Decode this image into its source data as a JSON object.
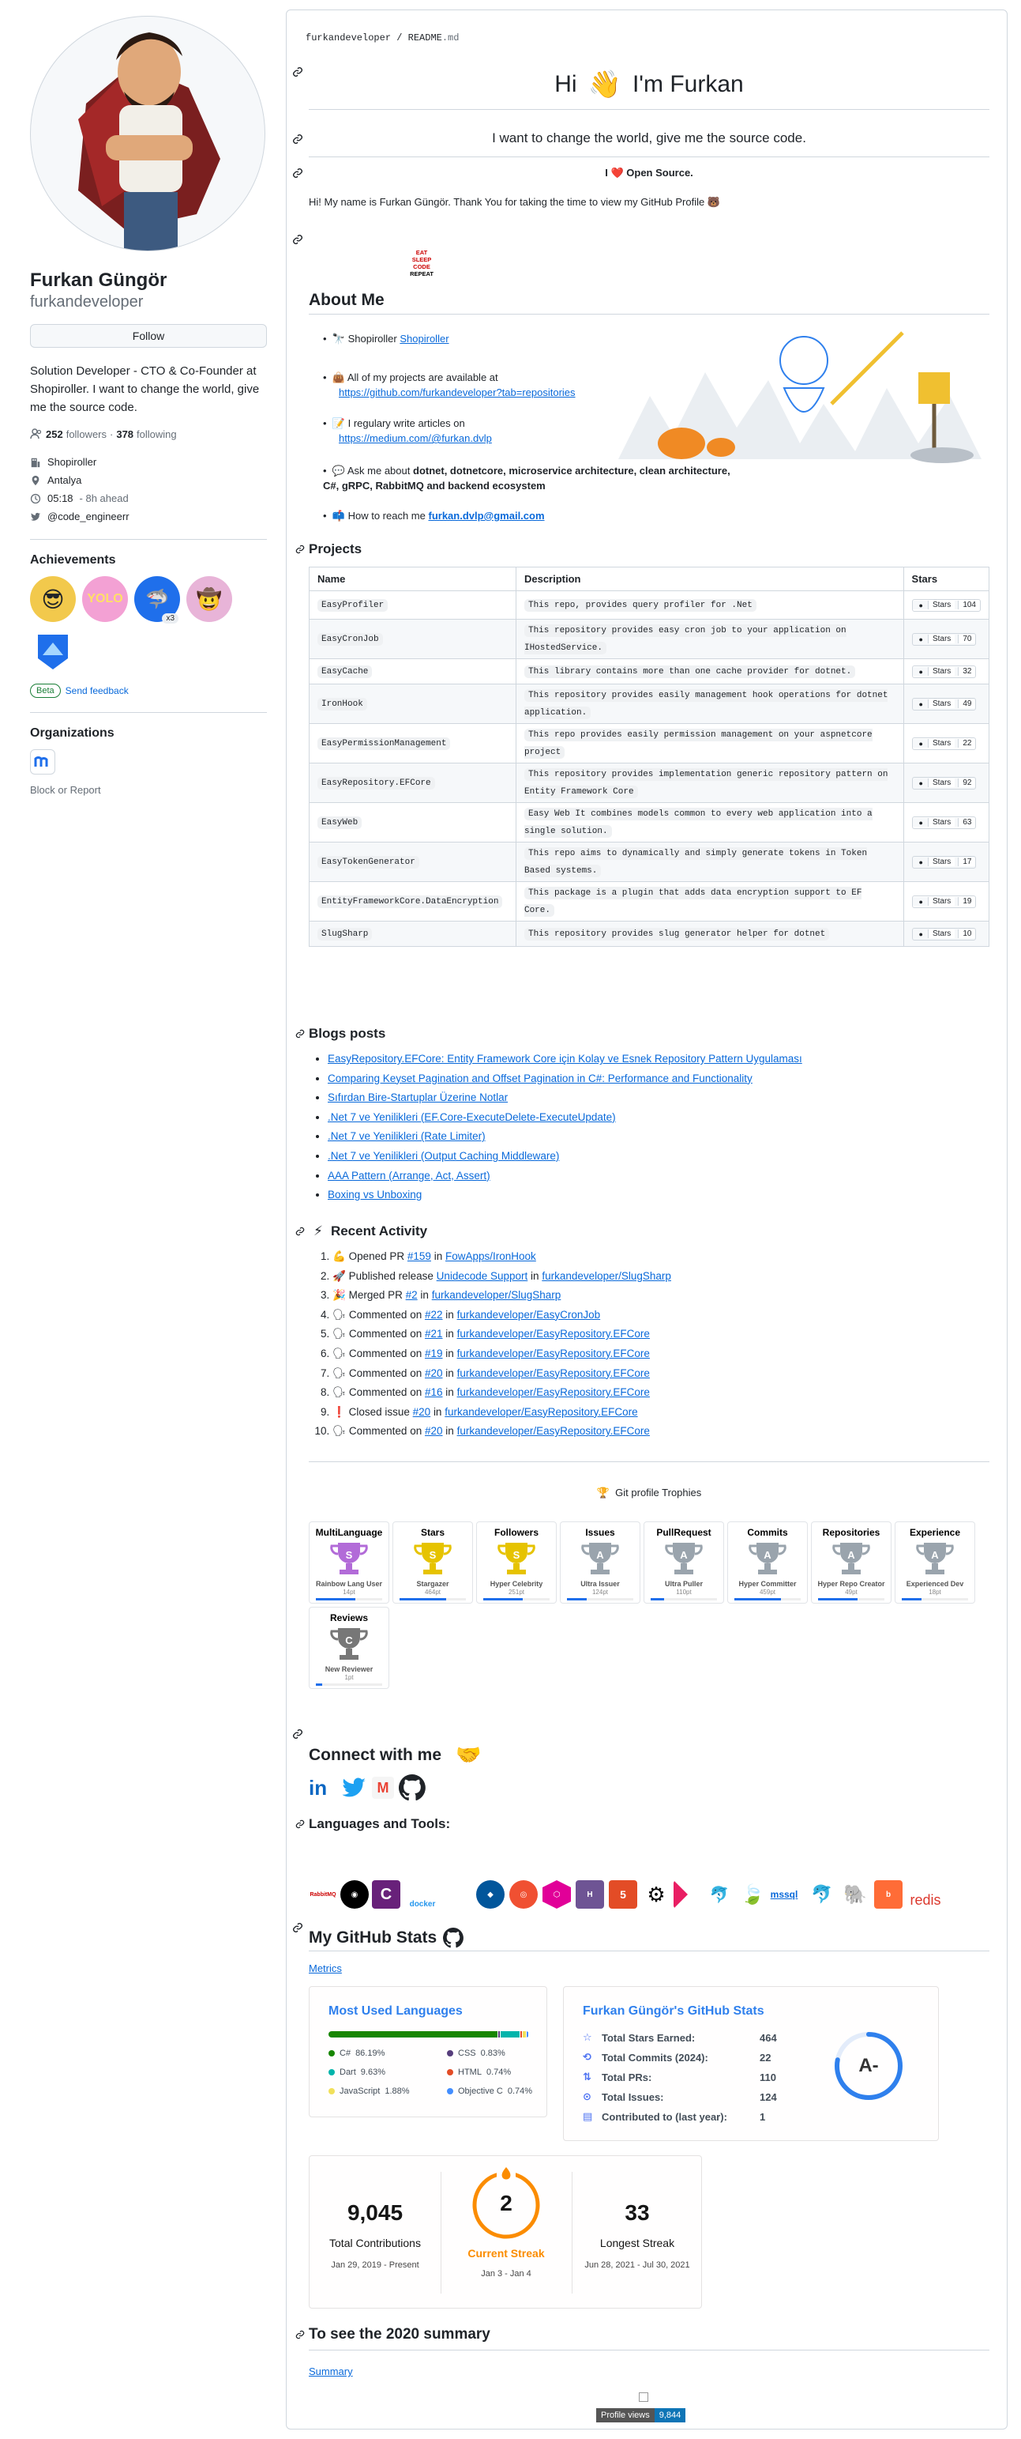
{
  "profile": {
    "name": "Furkan Güngör",
    "login": "furkandeveloper",
    "follow_label": "Follow",
    "bio": "Solution Developer - CTO & Co-Founder at Shopiroller. I want to change the world, give me the source code.",
    "followers": "252",
    "followers_label": "followers",
    "following": "378",
    "following_label": "following",
    "company": "Shopiroller",
    "location": "Antalya",
    "time": "05:18",
    "time_ahead": "- 8h ahead",
    "twitter": "@code_engineerr",
    "achievements_title": "Achievements",
    "achievement_count": "x3",
    "beta": "Beta",
    "send_feedback": "Send feedback",
    "orgs_title": "Organizations",
    "block": "Block or Report"
  },
  "readme": {
    "path_user": "furkandeveloper",
    "path_file": "README",
    "path_ext": ".md",
    "hi": "Hi",
    "hi_name": "I'm Furkan",
    "tagline": "I want to change the world, give me the source code.",
    "love_pre": "I",
    "love_post": "Open Source.",
    "intro": "Hi! My name is Furkan Güngör. Thank You for taking the time to view my GitHub Profile",
    "eat_lines": [
      "EAT",
      "SLEEP",
      "CODE",
      "REPEAT"
    ],
    "about_title": "About Me",
    "about": {
      "item1_text": "Shopiroller",
      "item1_link": "Shopiroller",
      "item2_text": "All of my projects are available at",
      "item2_link": "https://github.com/furkandeveloper?tab=repositories",
      "item3_text": "I regulary write articles on",
      "item3_link": "https://medium.com/@furkan.dvlp",
      "item4_pre": "Ask me about",
      "item4_bold": "dotnet, dotnetcore, microservice architecture, clean architecture, C#, gRPC, RabbitMQ and backend ecosystem",
      "item5_text": "How to reach me",
      "item5_link": "furkan.dvlp@gmail.com"
    },
    "projects_title": "Projects",
    "projects_headers": [
      "Name",
      "Description",
      "Stars"
    ],
    "projects": [
      {
        "name": "EasyProfiler",
        "desc": "This repo, provides query profiler for .Net",
        "stars": "104"
      },
      {
        "name": "EasyCronJob",
        "desc": "This repository provides easy cron job to your application on IHostedService.",
        "stars": "70"
      },
      {
        "name": "EasyCache",
        "desc": " This library contains more than one cache provider for dotnet.",
        "stars": "32"
      },
      {
        "name": "IronHook",
        "desc": "This repository provides easily management hook operations for dotnet application.",
        "stars": "49"
      },
      {
        "name": "EasyPermissionManagement",
        "desc": "This repo provides easily permission management on your aspnetcore project",
        "stars": "22"
      },
      {
        "name": "EasyRepository.EFCore",
        "desc": "This repository provides implementation generic repository pattern on Entity Framework Core",
        "stars": "92"
      },
      {
        "name": "EasyWeb",
        "desc": "Easy Web It combines models common to every web application into a single solution.",
        "stars": "63"
      },
      {
        "name": "EasyTokenGenerator",
        "desc": "This repo aims to dynamically and simply generate tokens in Token Based systems.",
        "stars": "17"
      },
      {
        "name": "EntityFrameworkCore.DataEncryption",
        "desc": "This package is a plugin that adds data encryption support to EF Core. ",
        "stars": "19"
      },
      {
        "name": "SlugSharp",
        "desc": "This repository provides slug generator helper for dotnet",
        "stars": "10"
      }
    ],
    "stars_badge": "Stars",
    "blogs_title": "Blogs posts",
    "blogs": [
      "EasyRepository.EFCore: Entity Framework Core için Kolay ve Esnek Repository Pattern Uygulaması",
      "Comparing Keyset Pagination and Offset Pagination in C#: Performance and Functionality",
      "Sıfırdan Bire-Startuplar Üzerine Notlar",
      ".Net 7 ve Yenilikleri (EF.Core-ExecuteDelete-ExecuteUpdate)",
      ".Net 7 ve Yenilikleri (Rate Limiter)",
      ".Net 7 ve Yenilikleri (Output Caching Middleware)",
      "AAA Pattern (Arrange, Act, Assert)",
      "Boxing vs Unboxing"
    ],
    "activity_title": "Recent Activity",
    "activity": [
      {
        "icon": "💪",
        "action": "Opened PR",
        "ref": "#159",
        "in": "in",
        "repo": "FowApps/IronHook"
      },
      {
        "icon": "🚀",
        "action": "Published release",
        "ref": "Unidecode Support",
        "in": "in",
        "repo": "furkandeveloper/SlugSharp"
      },
      {
        "icon": "🎉",
        "action": "Merged PR",
        "ref": "#2",
        "in": "in",
        "repo": "furkandeveloper/SlugSharp"
      },
      {
        "icon": "🗣",
        "action": "Commented on",
        "ref": "#22",
        "in": "in",
        "repo": "furkandeveloper/EasyCronJob"
      },
      {
        "icon": "🗣",
        "action": "Commented on",
        "ref": "#21",
        "in": "in",
        "repo": "furkandeveloper/EasyRepository.EFCore"
      },
      {
        "icon": "🗣",
        "action": "Commented on",
        "ref": "#19",
        "in": "in",
        "repo": "furkandeveloper/EasyRepository.EFCore"
      },
      {
        "icon": "🗣",
        "action": "Commented on",
        "ref": "#20",
        "in": "in",
        "repo": "furkandeveloper/EasyRepository.EFCore"
      },
      {
        "icon": "🗣",
        "action": "Commented on",
        "ref": "#16",
        "in": "in",
        "repo": "furkandeveloper/EasyRepository.EFCore"
      },
      {
        "icon": "❗",
        "action": "Closed issue",
        "ref": "#20",
        "in": "in",
        "repo": "furkandeveloper/EasyRepository.EFCore"
      },
      {
        "icon": "🗣",
        "action": "Commented on",
        "ref": "#20",
        "in": "in",
        "repo": "furkandeveloper/EasyRepository.EFCore"
      }
    ],
    "trophies_title": "Git profile Trophies",
    "trophies": [
      {
        "title": "MultiLanguage",
        "rank": "S",
        "name": "Rainbow Lang User",
        "pts": "14pt",
        "progress": 0.6,
        "color": "#b26bd8"
      },
      {
        "title": "Stars",
        "rank": "S",
        "name": "Stargazer",
        "pts": "464pt",
        "progress": 0.7,
        "color": "#e6c300"
      },
      {
        "title": "Followers",
        "rank": "S",
        "name": "Hyper Celebrity",
        "pts": "251pt",
        "progress": 0.6,
        "color": "#e6c300"
      },
      {
        "title": "Issues",
        "rank": "A",
        "name": "Ultra Issuer",
        "pts": "124pt",
        "progress": 0.3,
        "color": "#9aa4ad"
      },
      {
        "title": "PullRequest",
        "rank": "A",
        "name": "Ultra Puller",
        "pts": "110pt",
        "progress": 0.2,
        "color": "#9aa4ad"
      },
      {
        "title": "Commits",
        "rank": "A",
        "name": "Hyper Committer",
        "pts": "459pt",
        "progress": 0.7,
        "color": "#9aa4ad"
      },
      {
        "title": "Repositories",
        "rank": "A",
        "name": "Hyper Repo Creator",
        "pts": "49pt",
        "progress": 0.6,
        "color": "#9aa4ad"
      },
      {
        "title": "Experience",
        "rank": "A",
        "name": "Experienced Dev",
        "pts": "18pt",
        "progress": 0.3,
        "color": "#9aa4ad"
      },
      {
        "title": "Reviews",
        "rank": "C",
        "name": "New Reviewer",
        "pts": "1pt",
        "progress": 0.1,
        "color": "#777"
      }
    ],
    "connect_title": "Connect with me",
    "tools_title": "Languages and Tools:",
    "tools_labels": {
      "mssql": "mssql",
      "redis": "redis",
      "docker": "docker",
      ".net": ".NET"
    },
    "stats_title": "My GitHub Stats",
    "metrics_alt": "Metrics",
    "langs_title": "Most Used Languages",
    "langs": [
      {
        "name": "C#",
        "pct": "86.19%",
        "value": 86.19,
        "color": "#178600"
      },
      {
        "name": "CSS",
        "pct": "0.83%",
        "value": 0.83,
        "color": "#563d7c"
      },
      {
        "name": "Dart",
        "pct": "9.63%",
        "value": 9.63,
        "color": "#00B4AB"
      },
      {
        "name": "HTML",
        "pct": "0.74%",
        "value": 0.74,
        "color": "#e34c26"
      },
      {
        "name": "JavaScript",
        "pct": "1.88%",
        "value": 1.88,
        "color": "#f1e05a"
      },
      {
        "name": "Objective C",
        "pct": "0.74%",
        "value": 0.74,
        "color": "#438eff"
      }
    ],
    "gh_title": "Furkan Güngör's GitHub Stats",
    "gh_rows": [
      {
        "label": "Total Stars Earned:",
        "value": "464"
      },
      {
        "label": "Total Commits (2024):",
        "value": "22"
      },
      {
        "label": "Total PRs:",
        "value": "110"
      },
      {
        "label": "Total Issues:",
        "value": "124"
      },
      {
        "label": "Contributed to (last year):",
        "value": "1"
      }
    ],
    "gh_grade": "A-",
    "streak": {
      "total": "9,045",
      "total_label": "Total Contributions",
      "total_range": "Jan 29, 2019 - Present",
      "current": "2",
      "current_label": "Current Streak",
      "current_range": "Jan 3 - Jan 4",
      "longest": "33",
      "longest_label": "Longest Streak",
      "longest_range": "Jun 28, 2021 - Jul 30, 2021"
    },
    "summary_title": "To see the 2020 summary",
    "summary_link": "Summary",
    "views_label": "Profile views",
    "views": "9,844"
  },
  "colors": {
    "link": "#0969da",
    "border": "#d0d7de",
    "accent_orange": "#fb8c00",
    "accent_blue": "#2f80ed"
  }
}
